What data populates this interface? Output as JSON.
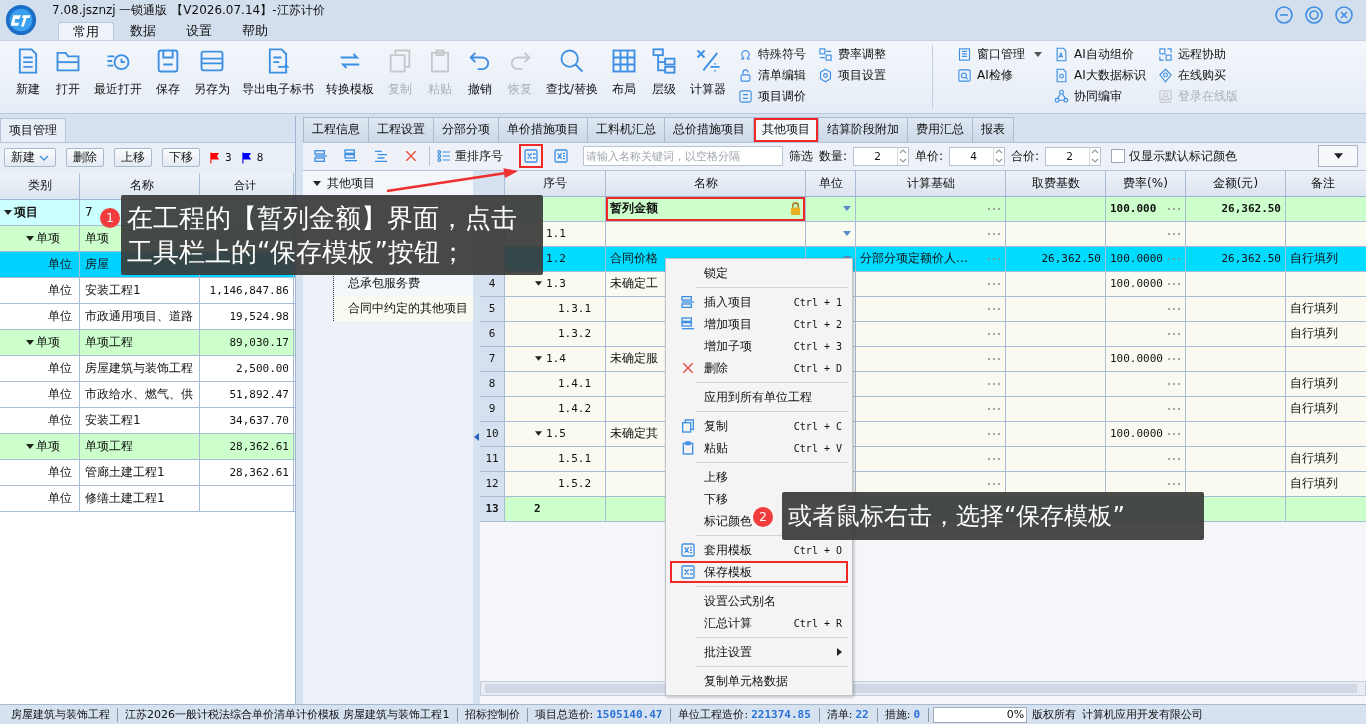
{
  "app": {
    "title": "7.08.jsznzj 一锁通版 【V2026.07.14】-江苏计价"
  },
  "ribbon_tabs": [
    {
      "label": "常用",
      "selected": true
    },
    {
      "label": "数据",
      "selected": false
    },
    {
      "label": "设置",
      "selected": false
    },
    {
      "label": "帮助",
      "selected": false
    }
  ],
  "toolbar": {
    "large": [
      {
        "label": "新建",
        "disabled": false
      },
      {
        "label": "打开",
        "disabled": false
      },
      {
        "label": "最近打开",
        "disabled": false
      },
      {
        "label": "保存",
        "disabled": false
      },
      {
        "label": "另存为",
        "disabled": false
      },
      {
        "label": "导出电子标书",
        "disabled": false
      },
      {
        "label": "转换模板",
        "disabled": false
      },
      {
        "label": "复制",
        "disabled": true
      },
      {
        "label": "粘贴",
        "disabled": true
      },
      {
        "label": "撤销",
        "disabled": false
      },
      {
        "label": "恢复",
        "disabled": true
      },
      {
        "label": "查找/替换",
        "disabled": false
      },
      {
        "label": "布局",
        "disabled": false
      },
      {
        "label": "层级",
        "disabled": false
      },
      {
        "label": "计算器",
        "disabled": false
      }
    ],
    "small_groups": [
      [
        {
          "label": "特殊符号",
          "disabled": false,
          "has_menu": false
        },
        {
          "label": "清单编辑",
          "disabled": false,
          "has_menu": false
        },
        {
          "label": "项目调价",
          "disabled": false,
          "has_menu": false
        }
      ],
      [
        {
          "label": "费率调整",
          "disabled": false,
          "has_menu": false
        },
        {
          "label": "项目设置",
          "disabled": false,
          "has_menu": false
        }
      ]
    ],
    "right_groups": [
      [
        {
          "label": "窗口管理",
          "disabled": false,
          "has_menu": true
        },
        {
          "label": "AI检修",
          "disabled": false,
          "has_menu": false
        }
      ],
      [
        {
          "label": "AI自动组价",
          "disabled": false,
          "has_menu": false
        },
        {
          "label": "AI大数据标识",
          "disabled": false,
          "has_menu": false
        },
        {
          "label": "协同编审",
          "disabled": false,
          "has_menu": false
        }
      ],
      [
        {
          "label": "远程协助",
          "disabled": false,
          "has_menu": false
        },
        {
          "label": "在线购买",
          "disabled": false,
          "has_menu": false
        },
        {
          "label": "登录在线版",
          "disabled": true,
          "has_menu": false
        }
      ]
    ]
  },
  "left_panel": {
    "tab": "项目管理",
    "buttons": [
      {
        "label": "新建",
        "has_menu": true
      },
      {
        "label": "删除",
        "has_menu": false
      },
      {
        "label": "上移",
        "has_menu": false
      },
      {
        "label": "下移",
        "has_menu": false
      }
    ],
    "flags": [
      {
        "color": "#ff0000",
        "count": "3"
      },
      {
        "color": "#0000ff",
        "count": "8"
      }
    ],
    "columns": [
      "类别",
      "名称",
      "合计"
    ],
    "rows": [
      {
        "type": "项目",
        "name": "7",
        "selected": false,
        "expanded": true,
        "children": [
          {
            "type": "单项",
            "name": "单项",
            "selected": false,
            "expanded": true,
            "children": [
              {
                "type": "单位",
                "name": "房屋",
                "selected": true
              },
              {
                "type": "单位",
                "name": "安装工程1",
                "total": "1,146,847.86",
                "selected": false
              },
              {
                "type": "单位",
                "name": "市政通用项目、道路",
                "total": "19,524.98",
                "selected": false
              }
            ]
          },
          {
            "type": "单项",
            "name": "单项工程",
            "total": "89,030.17",
            "selected": false,
            "expanded": true,
            "children": [
              {
                "type": "单位",
                "name": "房屋建筑与装饰工程",
                "total": "2,500.00",
                "selected": false
              },
              {
                "type": "单位",
                "name": "市政给水、燃气、供",
                "total": "51,892.47",
                "selected": false
              },
              {
                "type": "单位",
                "name": "安装工程1",
                "total": "34,637.70",
                "selected": false
              }
            ]
          },
          {
            "type": "单项",
            "name": "单项工程",
            "total": "28,362.61",
            "selected": false,
            "expanded": true,
            "children": [
              {
                "type": "单位",
                "name": "管廊土建工程1",
                "total": "28,362.61",
                "selected": false
              },
              {
                "type": "单位",
                "name": "修缮土建工程1",
                "selected": false
              }
            ]
          }
        ]
      }
    ]
  },
  "sub_tabs": [
    {
      "label": "工程信息",
      "selected": false,
      "highlighted": false
    },
    {
      "label": "工程设置",
      "selected": false,
      "highlighted": false
    },
    {
      "label": "分部分项",
      "selected": false,
      "highlighted": false
    },
    {
      "label": "单价措施项目",
      "selected": false,
      "highlighted": false
    },
    {
      "label": "工料机汇总",
      "selected": false,
      "highlighted": false
    },
    {
      "label": "总价措施项目",
      "selected": false,
      "highlighted": false
    },
    {
      "label": "其他项目",
      "selected": true,
      "highlighted": true
    },
    {
      "label": "结算阶段附加",
      "selected": false,
      "highlighted": false
    },
    {
      "label": "费用汇总",
      "selected": false,
      "highlighted": false
    },
    {
      "label": "报表",
      "selected": false,
      "highlighted": false
    }
  ],
  "sub_toolbar": {
    "template_buttons": [
      {
        "highlighted": true
      },
      {
        "highlighted": false
      }
    ],
    "reorder": "重排序号",
    "search_placeholder": "请输入名称关键词，以空格分隔",
    "filter": "筛选",
    "spinners": [
      {
        "label": "数量:",
        "value": "2"
      },
      {
        "label": "单价:",
        "value": "4"
      },
      {
        "label": "合价:",
        "value": "2"
      }
    ],
    "checkbox": {
      "label": "仅显示默认标记颜色",
      "checked": false
    }
  },
  "tree": {
    "label": "其他项目",
    "expanded": true,
    "children": [
      {
        "label": "总承包服务费"
      },
      {
        "label": "合同中约定的其他项目"
      }
    ]
  },
  "grid": {
    "columns": [
      "序号",
      "名称",
      "单位",
      "计算基础",
      "取费基数",
      "费率(%)",
      "金额(元)",
      "备注"
    ],
    "rows": [
      {
        "selected": false,
        "editable": true,
        "locked": true,
        "highlighted": true,
        "name": "暂列金额",
        "rate": "100.000",
        "amount": "26,362.50",
        "children": [
          {
            "selected": false,
            "editable": true,
            "locked": false,
            "highlighted": false,
            "seq": "1.1"
          },
          {
            "selected": true,
            "editable": true,
            "locked": false,
            "highlighted": false,
            "seq": "1.2",
            "name": "合同价格",
            "basis": "分部分项定额价人…",
            "base": "26,362.50",
            "rate": "100.0000",
            "amount": "26,362.50",
            "note": "自行填列"
          },
          {
            "no": "4",
            "selected": false,
            "editable": true,
            "locked": false,
            "highlighted": false,
            "seq": "1.3",
            "name": "未确定工",
            "rate": "100.0000",
            "children": [
              {
                "no": "5",
                "selected": false,
                "editable": true,
                "locked": false,
                "highlighted": false,
                "seq": "1.3.1",
                "note": "自行填列"
              },
              {
                "no": "6",
                "selected": false,
                "editable": true,
                "locked": false,
                "highlighted": false,
                "seq": "1.3.2",
                "note": "自行填列"
              }
            ]
          },
          {
            "no": "7",
            "selected": false,
            "editable": true,
            "locked": false,
            "highlighted": false,
            "seq": "1.4",
            "name": "未确定服",
            "rate": "100.0000",
            "children": [
              {
                "no": "8",
                "selected": false,
                "editable": true,
                "locked": false,
                "highlighted": false,
                "seq": "1.4.1",
                "note": "自行填列"
              },
              {
                "no": "9",
                "selected": false,
                "editable": true,
                "locked": false,
                "highlighted": false,
                "seq": "1.4.2",
                "note": "自行填列"
              }
            ]
          },
          {
            "no": "10",
            "selected": false,
            "editable": true,
            "locked": false,
            "highlighted": false,
            "seq": "1.5",
            "name": "未确定其",
            "rate": "100.0000",
            "children": [
              {
                "no": "11",
                "selected": false,
                "editable": true,
                "locked": false,
                "highlighted": false,
                "seq": "1.5.1",
                "note": "自行填列"
              },
              {
                "no": "12",
                "selected": false,
                "editable": true,
                "locked": false,
                "highlighted": false,
                "seq": "1.5.2",
                "note": "自行填列"
              }
            ]
          }
        ]
      },
      {
        "no": "13",
        "selected": false,
        "editable": false,
        "locked": false,
        "highlighted": false,
        "seq": "2"
      }
    ]
  },
  "context_menu": [
    {
      "kind": "item",
      "label": "锁定",
      "highlighted": false,
      "submenu": false
    },
    {
      "kind": "separator"
    },
    {
      "kind": "item",
      "label": "插入项目",
      "shortcut": "Ctrl + 1",
      "highlighted": false,
      "submenu": false
    },
    {
      "kind": "item",
      "label": "增加项目",
      "shortcut": "Ctrl + 2",
      "highlighted": false,
      "submenu": false
    },
    {
      "kind": "item",
      "label": "增加子项",
      "shortcut": "Ctrl + 3",
      "highlighted": false,
      "submenu": false
    },
    {
      "kind": "item",
      "label": "删除",
      "shortcut": "Ctrl + D",
      "highlighted": false,
      "submenu": false
    },
    {
      "kind": "separator"
    },
    {
      "kind": "item",
      "label": "应用到所有单位工程",
      "highlighted": false,
      "submenu": false
    },
    {
      "kind": "separator"
    },
    {
      "kind": "item",
      "label": "复制",
      "shortcut": "Ctrl + C",
      "highlighted": false,
      "submenu": false
    },
    {
      "kind": "item",
      "label": "粘贴",
      "shortcut": "Ctrl + V",
      "highlighted": false,
      "submenu": false
    },
    {
      "kind": "separator"
    },
    {
      "kind": "item",
      "label": "上移",
      "highlighted": false,
      "submenu": false
    },
    {
      "kind": "item",
      "label": "下移",
      "highlighted": false,
      "submenu": false
    },
    {
      "kind": "item",
      "label": "标记颜色",
      "highlighted": false,
      "submenu": false
    },
    {
      "kind": "separator"
    },
    {
      "kind": "item",
      "label": "套用模板",
      "shortcut": "Ctrl + O",
      "highlighted": false,
      "submenu": false
    },
    {
      "kind": "item",
      "label": "保存模板",
      "highlighted": true,
      "submenu": false
    },
    {
      "kind": "separator"
    },
    {
      "kind": "item",
      "label": "设置公式别名",
      "highlighted": false,
      "submenu": false
    },
    {
      "kind": "item",
      "label": "汇总计算",
      "shortcut": "Ctrl + R",
      "highlighted": false,
      "submenu": false
    },
    {
      "kind": "separator"
    },
    {
      "kind": "item",
      "label": "批注设置",
      "highlighted": false,
      "submenu": true
    },
    {
      "kind": "separator"
    },
    {
      "kind": "item",
      "label": "复制单元格数据",
      "highlighted": false,
      "submenu": false
    }
  ],
  "callouts": [
    {
      "badge": "1",
      "text": "在工程的【暂列金额】界面，点击工具栏上的“保存模板”按钮；"
    },
    {
      "badge": "2",
      "text": "或者鼠标右击，选择“保存模板”"
    }
  ],
  "status_bar": {
    "segments": [
      {
        "label": "房屋建筑与装饰工程"
      },
      {
        "label": "江苏2026一般计税法综合单价清单计价模板 房屋建筑与装饰工程1"
      },
      {
        "label": "招标控制价"
      },
      {
        "label": "项目总造价:",
        "value": "1505140.47"
      },
      {
        "label": "单位工程造价:",
        "value": "221374.85"
      },
      {
        "label": "清单:",
        "value": "22"
      },
      {
        "label": "措施:",
        "value": "0"
      }
    ],
    "progress": {
      "level": 0,
      "reading": "0%"
    },
    "copyright": [
      "版权所有",
      "计算机应用开发有限公司"
    ]
  }
}
